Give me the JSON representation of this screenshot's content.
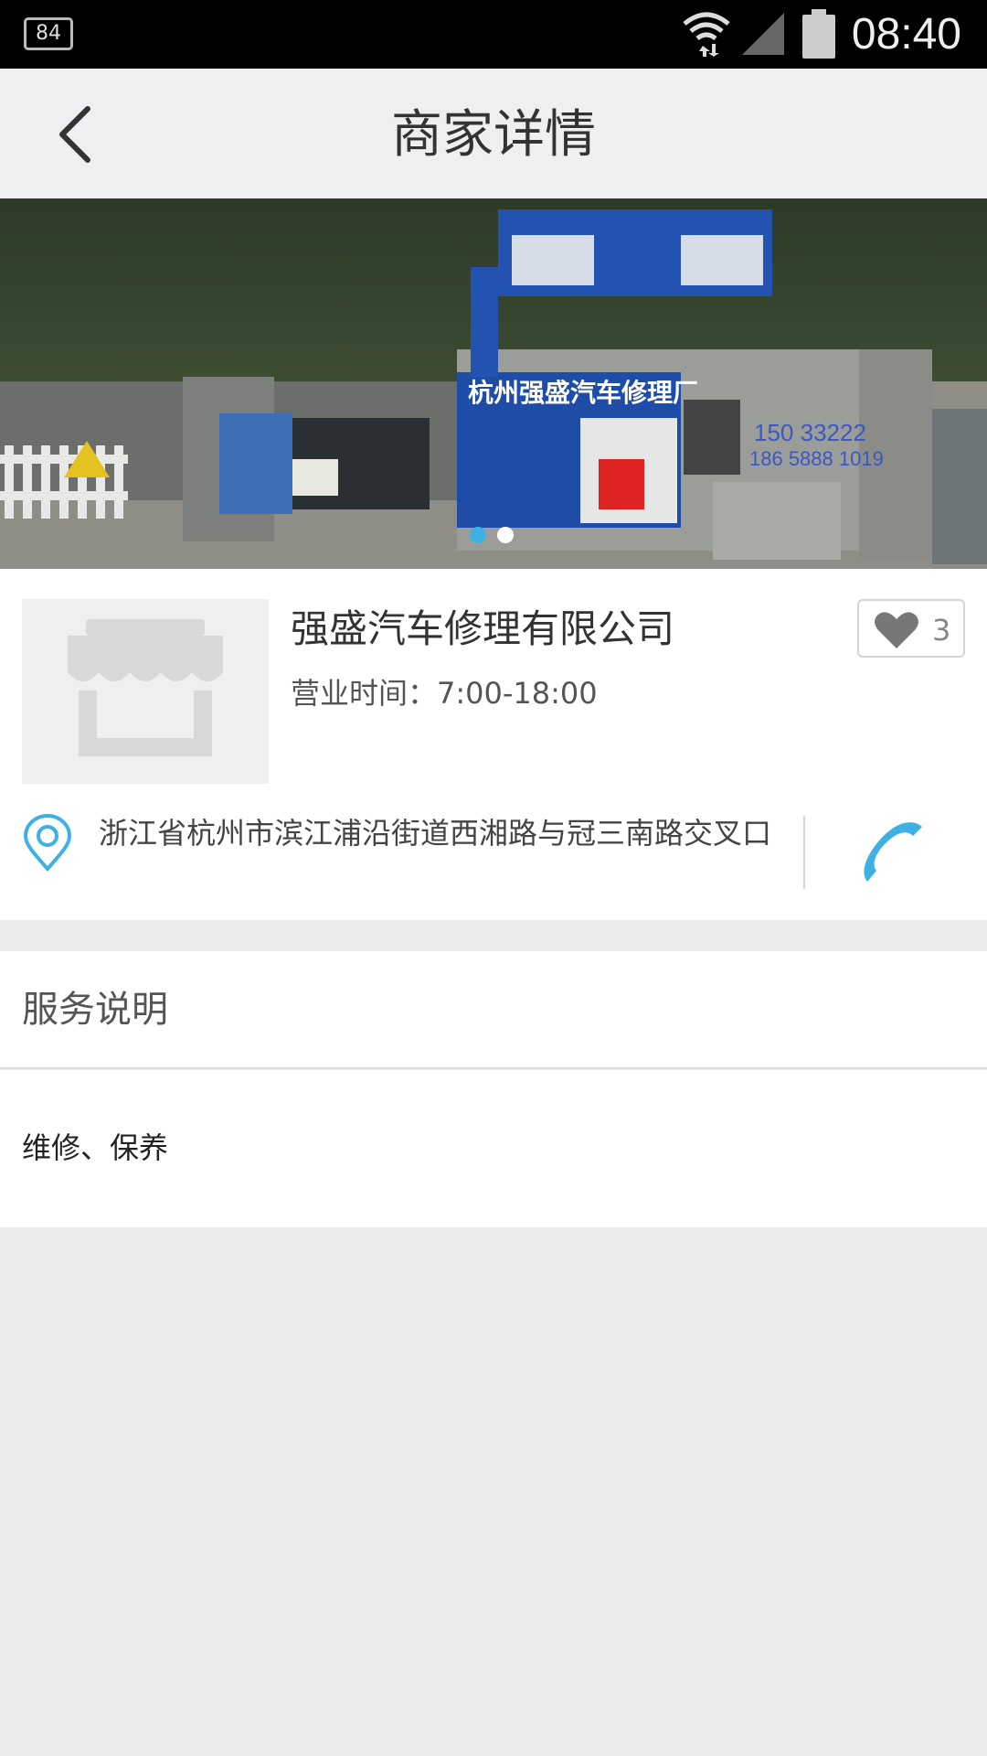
{
  "status_bar": {
    "notification_badge": "84",
    "time": "08:40",
    "icons": [
      "wifi-icon",
      "signal-icon",
      "battery-icon"
    ]
  },
  "app_bar": {
    "title": "商家详情",
    "back_icon": "chevron-left-icon"
  },
  "banner": {
    "carousel_pages": 2,
    "active_page": 1,
    "sign_text": "杭州强盛汽车修理厂"
  },
  "shop": {
    "name": "强盛汽车修理有限公司",
    "hours_label": "营业时间：",
    "hours_value": "7:00-18:00",
    "likes": "3",
    "address": "浙江省杭州市滨江浦沿街道西湘路与冠三南路交叉口"
  },
  "service": {
    "title": "服务说明",
    "description": "维修、保养"
  },
  "colors": {
    "accent": "#3fb0e4",
    "appbar_bg": "#efeff1",
    "page_bg": "#ebebed"
  }
}
